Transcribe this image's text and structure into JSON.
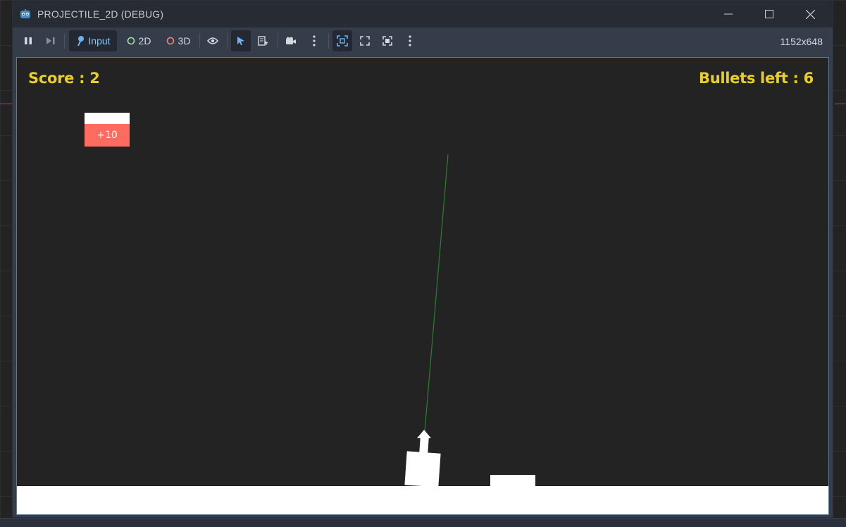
{
  "window": {
    "title": "PROJECTILE_2D (DEBUG)"
  },
  "toolbar": {
    "input_label": "Input",
    "twod_label": "2D",
    "threed_label": "3D",
    "resolution": "1152x648"
  },
  "game": {
    "score_text": "Score : 2",
    "bullets_text": "Bullets left : 6",
    "target_label": "+10"
  },
  "colors": {
    "hud_text": "#e9cf2a",
    "target": "#ff6b5f",
    "viewport_bg": "#232323",
    "trajectory": "#2e7d32"
  }
}
